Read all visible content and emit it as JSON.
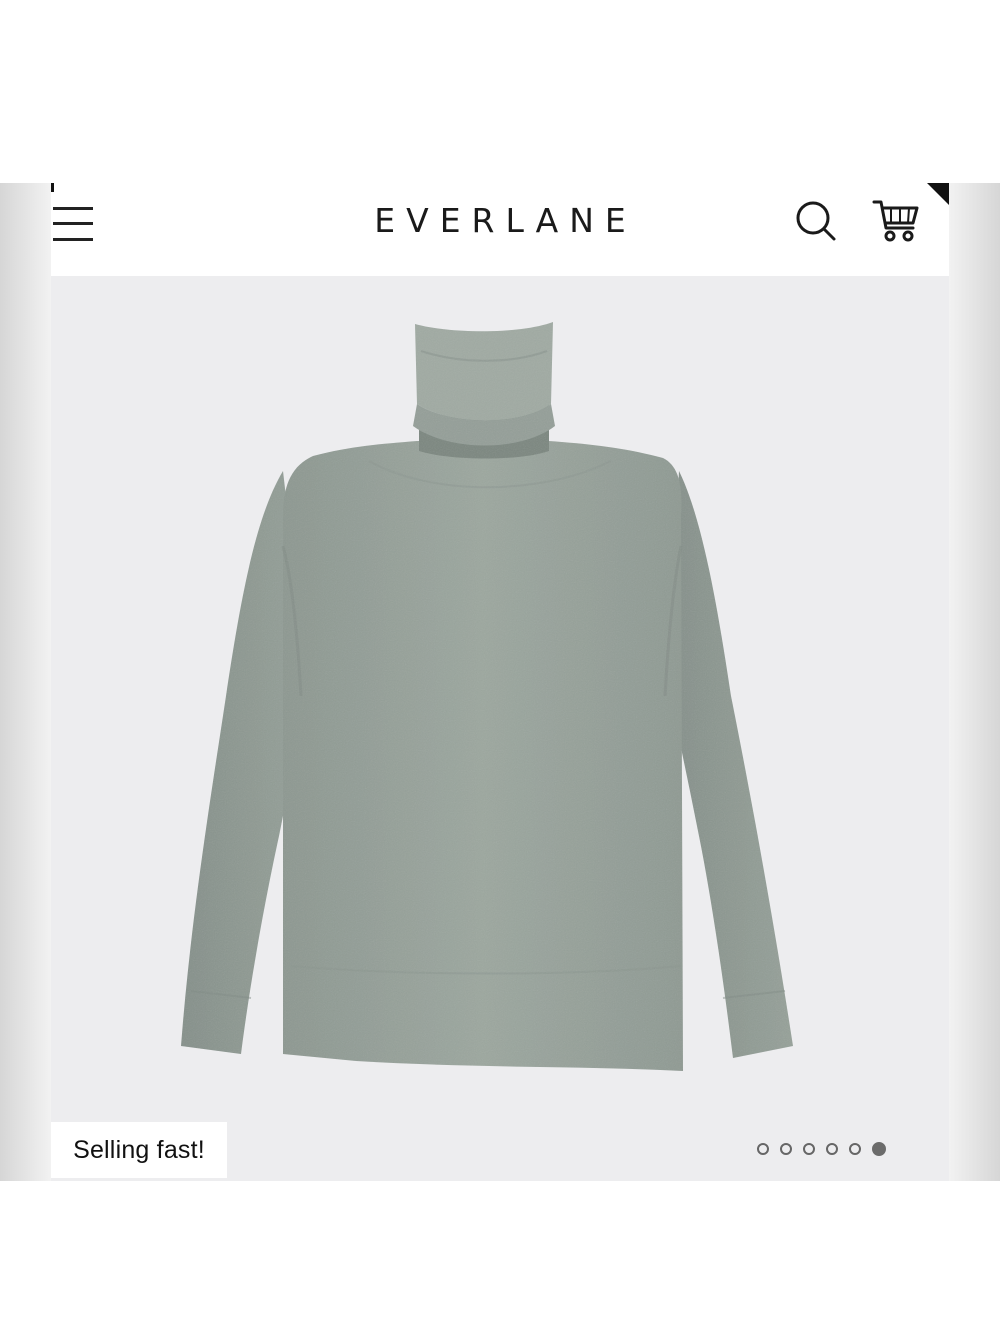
{
  "header": {
    "brand": "EVERLANE",
    "menu_icon": "hamburger-menu-icon",
    "search_icon": "search-icon",
    "cart_icon": "shopping-cart-icon"
  },
  "product_gallery": {
    "image_description": "gray turtleneck sweater",
    "badge_text": "Selling fast!",
    "image_count": 6,
    "active_image_index": 6,
    "dot_labels": [
      "1",
      "2",
      "3",
      "4",
      "5",
      "6"
    ]
  },
  "colors": {
    "sweater": "#98a39c",
    "gallery_background": "#ededef",
    "header_background": "#ffffff",
    "text": "#1a1a1a"
  }
}
